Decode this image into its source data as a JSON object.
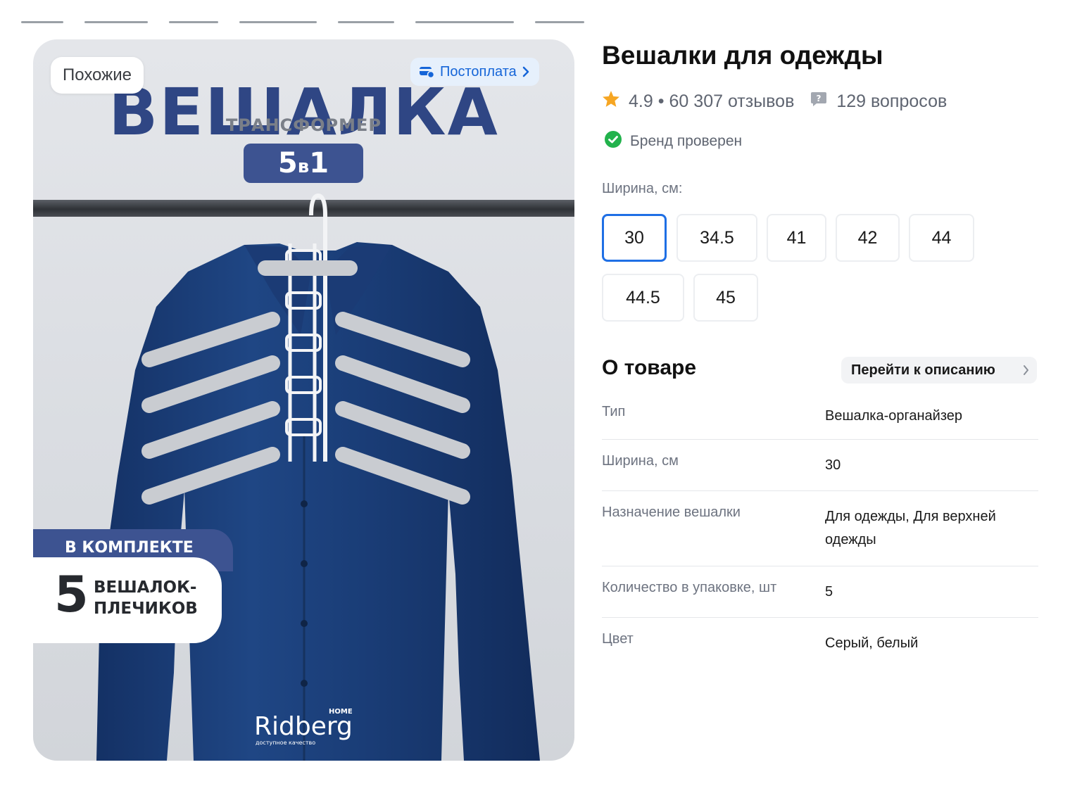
{
  "gallery": {
    "similar_label": "Похожие",
    "postpay_label": "Постоплата",
    "image": {
      "headline": "ВЕШАЛКА",
      "subheadline": "ТРАНСФОРМЕР",
      "badge_main": "5",
      "badge_small": "в",
      "badge_end": "1",
      "set_tag": "В КОМПЛЕКТЕ",
      "set_count": "5",
      "set_line1": "ВЕШАЛОК-",
      "set_line2": "ПЛЕЧИКОВ",
      "brand": "Ridberg",
      "brand_home": "HOME",
      "brand_slogan": "доступное качество"
    }
  },
  "product": {
    "title": "Вешалки для одежды",
    "rating": "4.9",
    "separator": "•",
    "reviews": "60 307 отзывов",
    "questions": "129 вопросов",
    "brand_verified": "Бренд проверен"
  },
  "width_selector": {
    "label": "Ширина, см:",
    "options": [
      "30",
      "34.5",
      "41",
      "42",
      "44",
      "44.5",
      "45"
    ],
    "selected": "30"
  },
  "about": {
    "heading": "О товаре",
    "goto_description": "Перейти к описанию",
    "specs": [
      {
        "key": "Тип",
        "value": "Вешалка-органайзер"
      },
      {
        "key": "Ширина, см",
        "value": "30"
      },
      {
        "key": "Назначение вешалки",
        "value": "Для одежды, Для верхней одежды"
      },
      {
        "key": "Количество в упаковке, шт",
        "value": "5"
      },
      {
        "key": "Цвет",
        "value": "Серый, белый"
      }
    ]
  },
  "colors": {
    "accent": "#1f6fe5",
    "postpay_bg": "#e6f0fc",
    "star": "#f6a623",
    "verified": "#22b24c",
    "shirt": "#1d3f7c"
  },
  "icons": {
    "rating": "star-icon",
    "questions": "question-bubble-icon",
    "verified": "check-circle-icon",
    "postpay": "card-icon",
    "chevron": "chevron-right-icon"
  }
}
